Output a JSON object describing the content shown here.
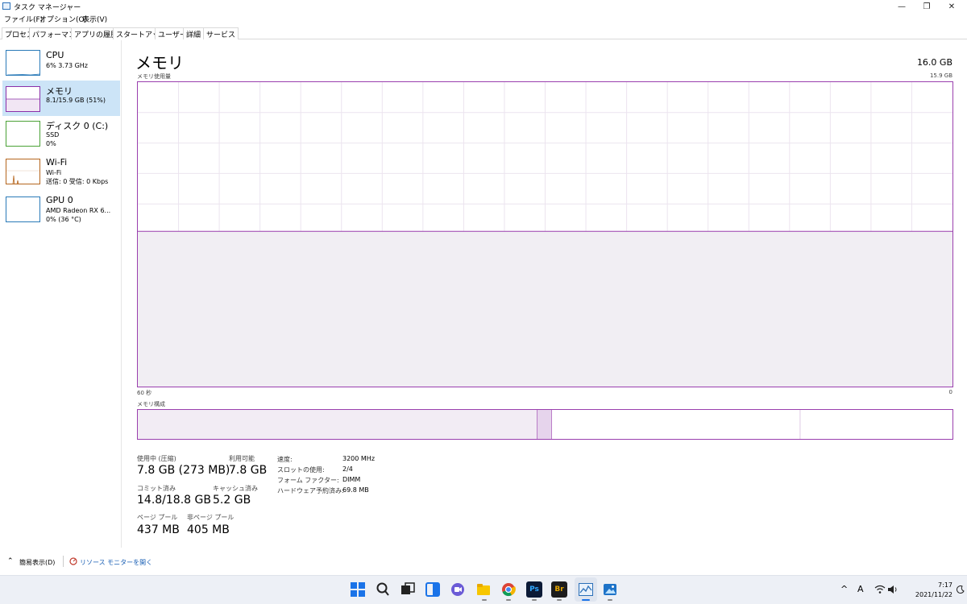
{
  "window": {
    "title": "タスク マネージャー",
    "controls": {
      "minimize": "—",
      "maximize": "❐",
      "close": "✕"
    }
  },
  "menu": [
    "ファイル(F)",
    "オプション(O)",
    "表示(V)"
  ],
  "tabs": [
    "プロセス",
    "パフォーマンス",
    "アプリの履歴",
    "スタートアップ",
    "ユーザー",
    "詳細",
    "サービス"
  ],
  "active_tab": "パフォーマンス",
  "sidebar": {
    "items": [
      {
        "title": "CPU",
        "lines": [
          "6% 3.73 GHz"
        ],
        "color": "#2a7ab8"
      },
      {
        "title": "メモリ",
        "lines": [
          "8.1/15.9 GB (51%)"
        ],
        "color": "#8b2fa8"
      },
      {
        "title": "ディスク 0 (C:)",
        "lines": [
          "SSD",
          "0%"
        ],
        "color": "#4aa135"
      },
      {
        "title": "Wi-Fi",
        "lines": [
          "Wi-Fi",
          "送信: 0 受信: 0 Kbps"
        ],
        "color": "#b5651d"
      },
      {
        "title": "GPU 0",
        "lines": [
          "AMD Radeon RX 6...",
          "0% (36 °C)"
        ],
        "color": "#2a7ab8"
      }
    ]
  },
  "main": {
    "title": "メモリ",
    "total": "16.0 GB",
    "usage_label": "メモリ使用量",
    "usage_max": "15.9 GB",
    "time_start": "60 秒",
    "time_end": "0",
    "composition_label": "メモリ構成",
    "usage_fraction": 0.51,
    "composition": {
      "in_use": 0.49,
      "modified": 0.018,
      "standby": 0.305,
      "free": 0.187
    },
    "accent": "#9a3fae"
  },
  "stats": {
    "in_use_label": "使用中 (圧縮)",
    "in_use_value": "7.8 GB (273 MB)",
    "available_label": "利用可能",
    "available_value": "7.8 GB",
    "committed_label": "コミット済み",
    "committed_value": "14.8/18.8 GB",
    "cached_label": "キャッシュ済み",
    "cached_value": "5.2 GB",
    "paged_label": "ページ プール",
    "paged_value": "437 MB",
    "nonpaged_label": "非ページ プール",
    "nonpaged_value": "405 MB"
  },
  "info": [
    {
      "label": "速度:",
      "value": "3200 MHz"
    },
    {
      "label": "スロットの使用:",
      "value": "2/4"
    },
    {
      "label": "フォーム ファクター:",
      "value": "DIMM"
    },
    {
      "label": "ハードウェア予約済み:",
      "value": "69.8 MB"
    }
  ],
  "footer": {
    "fewer_details": "簡易表示(D)",
    "resource_monitor": "リソース モニターを開く"
  },
  "taskbar": {
    "apps": [
      {
        "name": "windows-start",
        "label": "",
        "color": "#1a73e8"
      },
      {
        "name": "search",
        "label": "",
        "color": "#222"
      },
      {
        "name": "task-view",
        "label": "",
        "color": "#222"
      },
      {
        "name": "widgets",
        "label": "",
        "color": "#1a73e8"
      },
      {
        "name": "chat",
        "label": "",
        "color": "#6b5bd6"
      },
      {
        "name": "file-explorer",
        "label": "",
        "color": "#e8b400"
      },
      {
        "name": "chrome",
        "label": "",
        "color": "#db4437"
      },
      {
        "name": "photoshop",
        "label": "Ps",
        "color": "#0b1a36"
      },
      {
        "name": "bridge",
        "label": "Br",
        "color": "#1c1c1c"
      },
      {
        "name": "task-manager",
        "label": "",
        "color": "#2a6fb8"
      },
      {
        "name": "photos",
        "label": "",
        "color": "#1e73c8"
      }
    ],
    "tray": {
      "chevron": "^",
      "ime": "A",
      "time": "7:17",
      "date": "2021/11/22"
    }
  }
}
